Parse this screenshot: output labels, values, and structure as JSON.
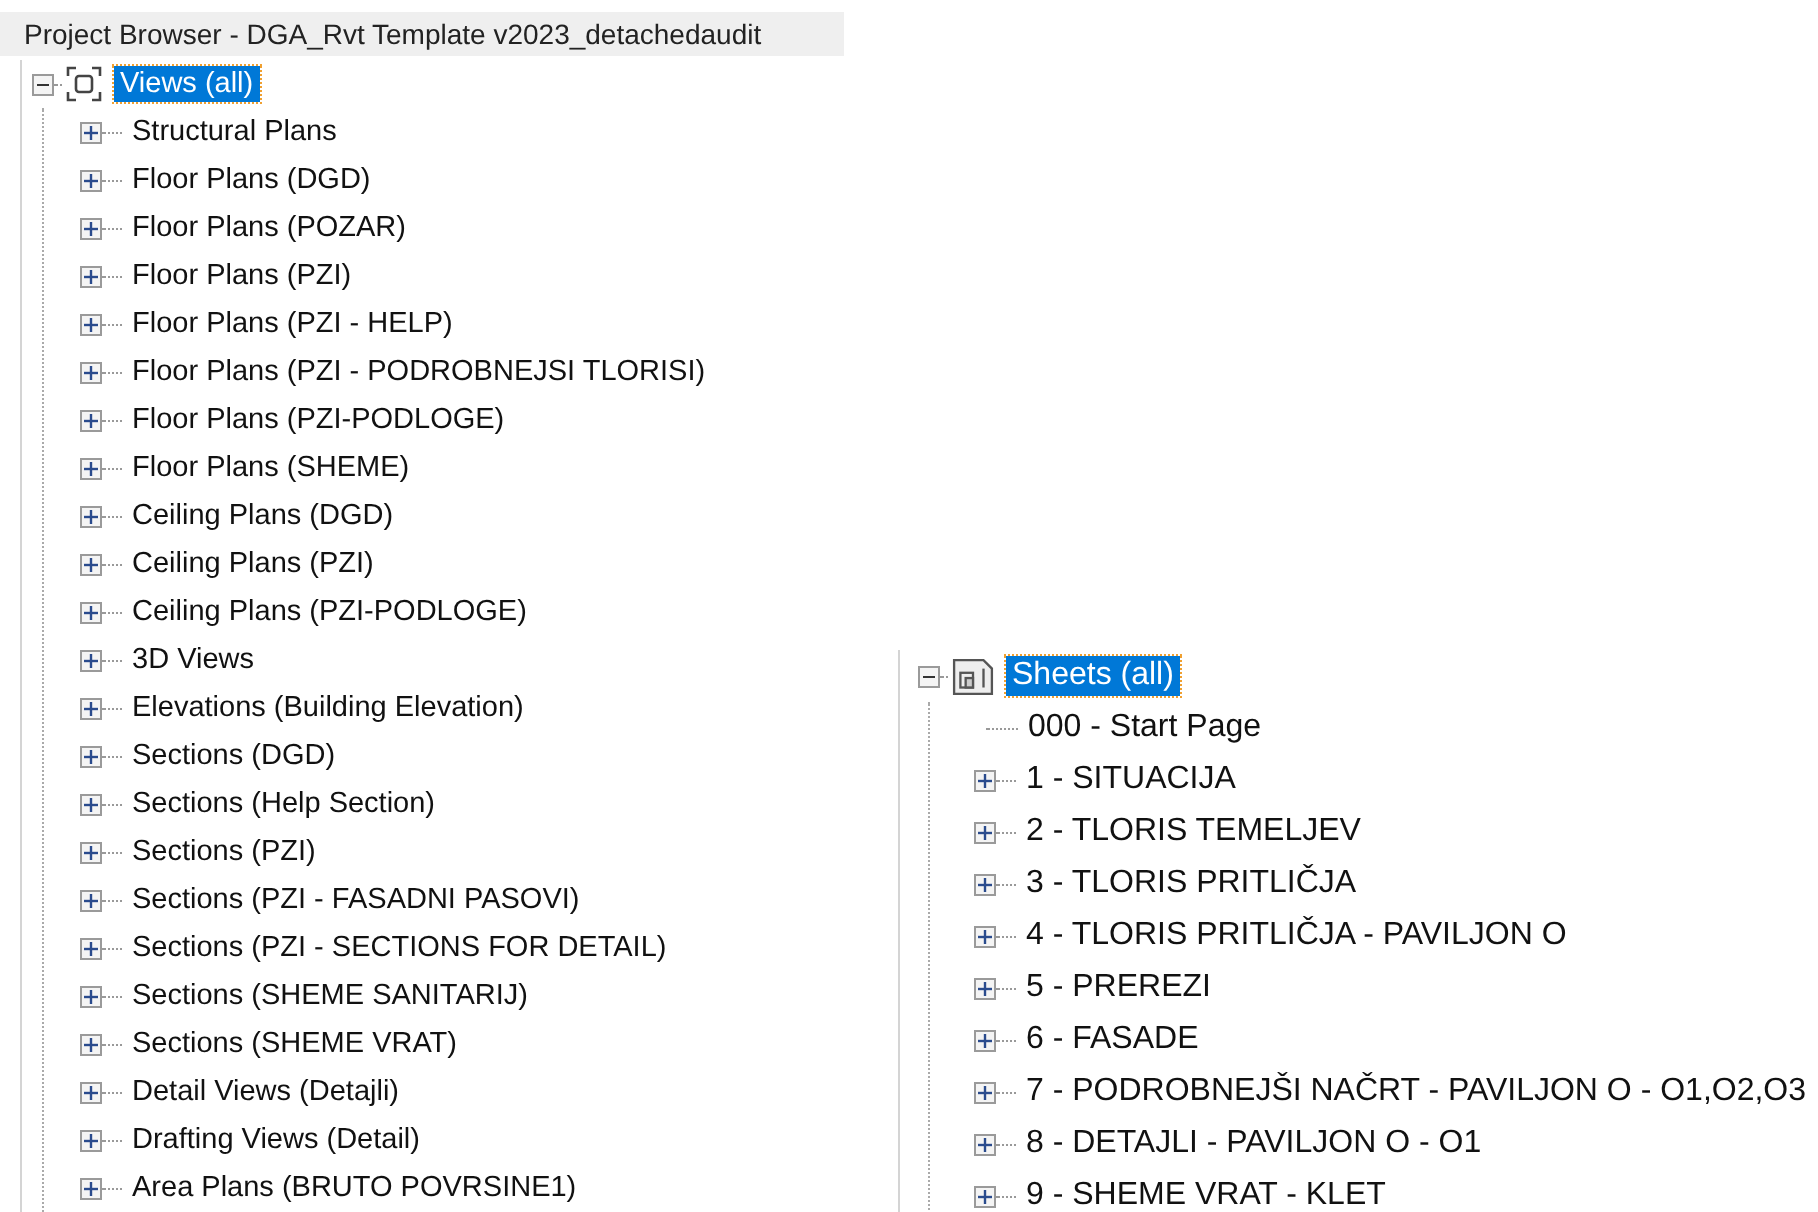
{
  "views_panel": {
    "title": "Project Browser - DGA_Rvt Template v2023_detachedaudit",
    "root": {
      "label": "Views (all)",
      "kind": "views",
      "expanded": true,
      "selected": true,
      "children": [
        {
          "label": "Structural Plans",
          "kind": "folder",
          "expanded": false,
          "selected": false
        },
        {
          "label": "Floor Plans (DGD)",
          "kind": "folder",
          "expanded": false,
          "selected": false
        },
        {
          "label": "Floor Plans (POZAR)",
          "kind": "folder",
          "expanded": false,
          "selected": false
        },
        {
          "label": "Floor Plans (PZI)",
          "kind": "folder",
          "expanded": false,
          "selected": false
        },
        {
          "label": "Floor Plans (PZI - HELP)",
          "kind": "folder",
          "expanded": false,
          "selected": false
        },
        {
          "label": "Floor Plans (PZI - PODROBNEJSI TLORISI)",
          "kind": "folder",
          "expanded": false,
          "selected": false
        },
        {
          "label": "Floor Plans (PZI-PODLOGE)",
          "kind": "folder",
          "expanded": false,
          "selected": false
        },
        {
          "label": "Floor Plans (SHEME)",
          "kind": "folder",
          "expanded": false,
          "selected": false
        },
        {
          "label": "Ceiling Plans (DGD)",
          "kind": "folder",
          "expanded": false,
          "selected": false
        },
        {
          "label": "Ceiling Plans (PZI)",
          "kind": "folder",
          "expanded": false,
          "selected": false
        },
        {
          "label": "Ceiling Plans (PZI-PODLOGE)",
          "kind": "folder",
          "expanded": false,
          "selected": false
        },
        {
          "label": "3D Views",
          "kind": "folder",
          "expanded": false,
          "selected": false
        },
        {
          "label": "Elevations (Building Elevation)",
          "kind": "folder",
          "expanded": false,
          "selected": false
        },
        {
          "label": "Sections (DGD)",
          "kind": "folder",
          "expanded": false,
          "selected": false
        },
        {
          "label": "Sections (Help Section)",
          "kind": "folder",
          "expanded": false,
          "selected": false
        },
        {
          "label": "Sections (PZI)",
          "kind": "folder",
          "expanded": false,
          "selected": false
        },
        {
          "label": "Sections (PZI - FASADNI PASOVI)",
          "kind": "folder",
          "expanded": false,
          "selected": false
        },
        {
          "label": "Sections (PZI - SECTIONS FOR DETAIL)",
          "kind": "folder",
          "expanded": false,
          "selected": false
        },
        {
          "label": "Sections (SHEME SANITARIJ)",
          "kind": "folder",
          "expanded": false,
          "selected": false
        },
        {
          "label": "Sections (SHEME VRAT)",
          "kind": "folder",
          "expanded": false,
          "selected": false
        },
        {
          "label": "Detail Views (Detajli)",
          "kind": "folder",
          "expanded": false,
          "selected": false
        },
        {
          "label": "Drafting Views (Detail)",
          "kind": "folder",
          "expanded": false,
          "selected": false
        },
        {
          "label": "Area Plans (BRUTO POVRSINE1)",
          "kind": "folder",
          "expanded": false,
          "selected": false
        }
      ]
    }
  },
  "sheets_panel": {
    "root": {
      "label": "Sheets (all)",
      "kind": "sheets",
      "expanded": true,
      "selected": true,
      "children": [
        {
          "label": "000 - Start Page",
          "kind": "leaf",
          "selected": false
        },
        {
          "label": "1 - SITUACIJA",
          "kind": "folder",
          "expanded": false,
          "selected": false
        },
        {
          "label": "2 - TLORIS TEMELJEV",
          "kind": "folder",
          "expanded": false,
          "selected": false
        },
        {
          "label": "3 - TLORIS PRITLIČJA",
          "kind": "folder",
          "expanded": false,
          "selected": false
        },
        {
          "label": "4 - TLORIS PRITLIČJA - PAVILJON O",
          "kind": "folder",
          "expanded": false,
          "selected": false
        },
        {
          "label": "5 - PREREZI",
          "kind": "folder",
          "expanded": false,
          "selected": false
        },
        {
          "label": "6 - FASADE",
          "kind": "folder",
          "expanded": false,
          "selected": false
        },
        {
          "label": "7 - PODROBNEJŠI NAČRT - PAVILJON O - O1,O2,O3",
          "kind": "folder",
          "expanded": false,
          "selected": false
        },
        {
          "label": "8 - DETAJLI - PAVILJON O - O1",
          "kind": "folder",
          "expanded": false,
          "selected": false
        },
        {
          "label": "9 - SHEME VRAT - KLET",
          "kind": "folder",
          "expanded": false,
          "selected": false
        }
      ]
    }
  }
}
